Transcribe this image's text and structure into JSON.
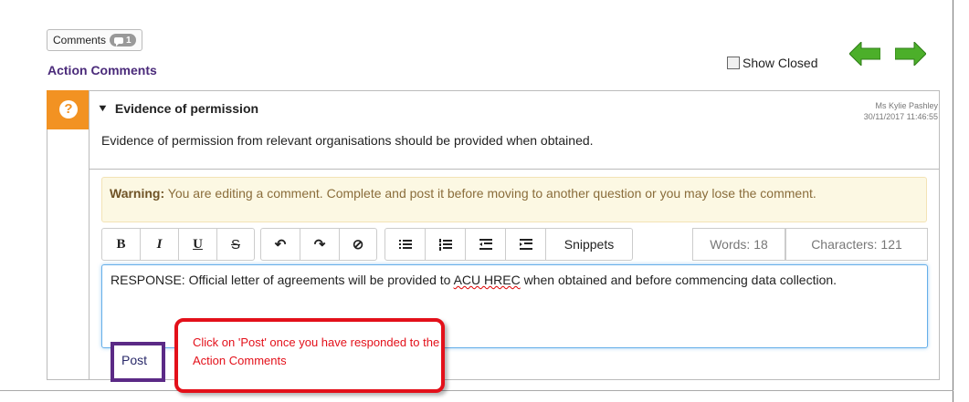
{
  "comments_tab": {
    "label": "Comments",
    "count": "1"
  },
  "section_title": "Action Comments",
  "show_closed_label": "Show Closed",
  "nav": {
    "prev_icon": "arrow-left-icon",
    "next_icon": "arrow-right-icon",
    "color": "#4caf2a"
  },
  "question": {
    "icon": "question-icon",
    "title": "Evidence of permission",
    "author": "Ms Kylie Pashley",
    "timestamp": "30/11/2017 11:46:55",
    "body": "Evidence of permission from relevant organisations should be provided when obtained."
  },
  "warning": {
    "label": "Warning:",
    "text": " You are editing a comment. Complete and post it before moving to another question or you may lose the comment."
  },
  "toolbar": {
    "bold": "B",
    "italic": "I",
    "underline": "U",
    "strike": "S",
    "undo": "↶",
    "redo": "↷",
    "clear": "⊘",
    "snippets": "Snippets",
    "words": "Words: 18",
    "characters": "Characters: 121"
  },
  "editor": {
    "before": "RESPONSE: Official letter of agreements will be provided to ",
    "acronym": "ACU HREC",
    "after": " when obtained and before commencing data collection."
  },
  "post_label": "Post",
  "callout_text": "Click on 'Post' once you have responded to the Action Comments",
  "colors": {
    "accent_orange": "#f29222",
    "title_purple": "#4a2a7a",
    "callout_red": "#e3101a"
  }
}
